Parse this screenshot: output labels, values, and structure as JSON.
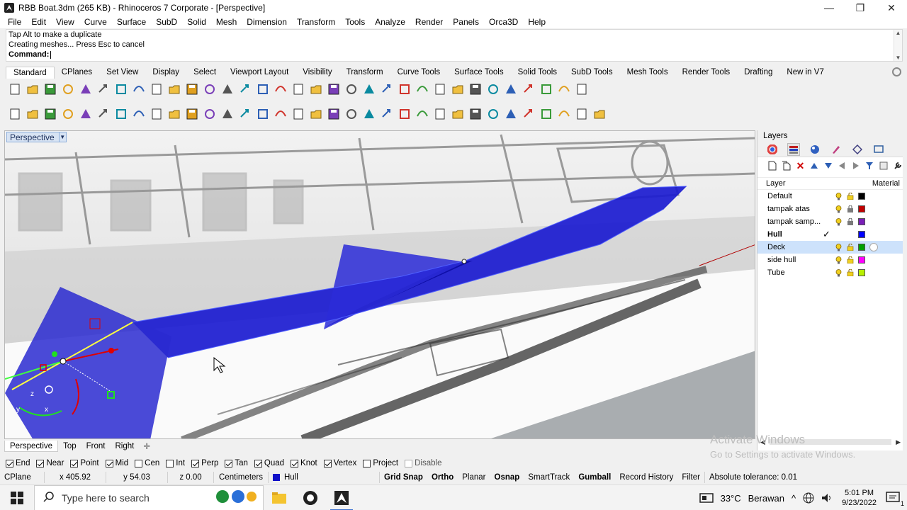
{
  "window": {
    "title": "RBB Boat.3dm (265 KB) - Rhinoceros 7 Corporate - [Perspective]",
    "minimize_glyph": "—",
    "maximize_glyph": "❐",
    "close_glyph": "✕"
  },
  "menu": [
    "File",
    "Edit",
    "View",
    "Curve",
    "Surface",
    "SubD",
    "Solid",
    "Mesh",
    "Dimension",
    "Transform",
    "Tools",
    "Analyze",
    "Render",
    "Panels",
    "Orca3D",
    "Help"
  ],
  "command": {
    "history": [
      "Tap Alt to make a duplicate",
      "Creating meshes... Press Esc to cancel"
    ],
    "prompt": "Command:",
    "value": ""
  },
  "toolbar_tabs": [
    "Standard",
    "CPlanes",
    "Set View",
    "Display",
    "Select",
    "Viewport Layout",
    "Visibility",
    "Transform",
    "Curve Tools",
    "Surface Tools",
    "Solid Tools",
    "SubD Tools",
    "Mesh Tools",
    "Render Tools",
    "Drafting",
    "New in V7"
  ],
  "active_toolbar_tab": "Standard",
  "standard_icons": [
    "new-icon",
    "open-icon",
    "save-icon",
    "print-icon",
    "import-icon",
    "cut-icon",
    "copy-icon",
    "paste-icon",
    "undo-icon",
    "pan-hand-icon",
    "move-view-icon",
    "zoom-icon",
    "zoom-window-icon",
    "zoom-extents-icon",
    "zoom-selected-icon",
    "rotate-view-icon",
    "four-viewports-icon",
    "car-icon",
    "cplane-icon",
    "target-icon",
    "light-bulb-icon",
    "lock-icon",
    "layer-stack-icon",
    "color-wheel-icon",
    "shaded-sphere-icon",
    "rendered-sphere-icon",
    "ghosted-sphere-icon",
    "blue-sphere-icon",
    "light-icon",
    "gear-settings-icon",
    "options-icon",
    "globe-icon",
    "help-icon"
  ],
  "sidebar_icons": [
    "select-arrow-icon",
    "point-icon",
    "polyline-icon",
    "curve-icon",
    "circle-icon",
    "ellipse-icon",
    "arc-icon",
    "rectangle-icon",
    "polygon-icon",
    "fillet-icon",
    "surface-icon",
    "extrude-icon",
    "box-icon",
    "boolean-icon",
    "cylinder-icon",
    "mesh-icon",
    "light-icon",
    "dimension-icon",
    "block-icon",
    "group-icon",
    "array-icon",
    "trim-icon",
    "text-icon",
    "scale-icon",
    "explode-icon",
    "analyze-icon",
    "cplane-grid-icon",
    "named-view-icon",
    "grid-icon",
    "snapshot-icon",
    "toolbox-icon",
    "check-icon",
    "eraser-icon",
    "paint-icon"
  ],
  "viewport": {
    "name": "Perspective",
    "axis_labels": {
      "z": "z",
      "y": "y",
      "x": "x"
    }
  },
  "layers": {
    "panel_title": "Layers",
    "header_layer": "Layer",
    "header_material": "Material",
    "rows": [
      {
        "name": "Default",
        "current": false,
        "bold": false,
        "color": "#000000",
        "selected": false,
        "locked": false
      },
      {
        "name": "tampak atas",
        "current": false,
        "bold": false,
        "color": "#c00000",
        "selected": false,
        "locked": true
      },
      {
        "name": "tampak samp...",
        "current": false,
        "bold": false,
        "color": "#7a1fb8",
        "selected": false,
        "locked": true
      },
      {
        "name": "Hull",
        "current": true,
        "bold": true,
        "color": "#0000ff",
        "selected": false,
        "locked": false
      },
      {
        "name": "Deck",
        "current": false,
        "bold": false,
        "color": "#00a000",
        "selected": true,
        "locked": false
      },
      {
        "name": "side hull",
        "current": false,
        "bold": false,
        "color": "#ff00ff",
        "selected": false,
        "locked": false
      },
      {
        "name": "Tube",
        "current": false,
        "bold": false,
        "color": "#b8f000",
        "selected": false,
        "locked": false
      }
    ],
    "current_check": "✓"
  },
  "watermark": {
    "line1": "Activate Windows",
    "line2": "Go to Settings to activate Windows."
  },
  "viewport_tabs": [
    "Perspective",
    "Top",
    "Front",
    "Right"
  ],
  "viewport_tab_add": "✛",
  "osnaps": [
    {
      "label": "End",
      "checked": true
    },
    {
      "label": "Near",
      "checked": true
    },
    {
      "label": "Point",
      "checked": true
    },
    {
      "label": "Mid",
      "checked": true
    },
    {
      "label": "Cen",
      "checked": false
    },
    {
      "label": "Int",
      "checked": false
    },
    {
      "label": "Perp",
      "checked": true
    },
    {
      "label": "Tan",
      "checked": true
    },
    {
      "label": "Quad",
      "checked": true
    },
    {
      "label": "Knot",
      "checked": true
    },
    {
      "label": "Vertex",
      "checked": true
    },
    {
      "label": "Project",
      "checked": false
    },
    {
      "label": "Disable",
      "checked": false
    }
  ],
  "status": {
    "cplane": "CPlane",
    "x": "x 405.92",
    "y": "y 54.03",
    "z": "z 0.00",
    "units": "Centimeters",
    "layer": "Hull",
    "toggles": [
      {
        "label": "Grid Snap",
        "active": true
      },
      {
        "label": "Ortho",
        "active": true
      },
      {
        "label": "Planar",
        "active": false
      },
      {
        "label": "Osnap",
        "active": true
      },
      {
        "label": "SmartTrack",
        "active": false
      },
      {
        "label": "Gumball",
        "active": true
      },
      {
        "label": "Record History",
        "active": false
      },
      {
        "label": "Filter",
        "active": false
      }
    ],
    "tolerance": "Absolute tolerance: 0.01"
  },
  "taskbar": {
    "search_placeholder": "Type here to search",
    "apps": [
      "cortana-icon",
      "file-explorer-icon",
      "obs-icon",
      "rhino-icon"
    ],
    "weather_temp": "33°C",
    "weather_desc": "Berawan",
    "time": "5:01 PM",
    "date": "9/23/2022",
    "caret_up": "^",
    "notification_badge": "1"
  },
  "colors": {
    "hull_blue": "#1b1bd0",
    "selection_blue": "#cde2fb"
  }
}
